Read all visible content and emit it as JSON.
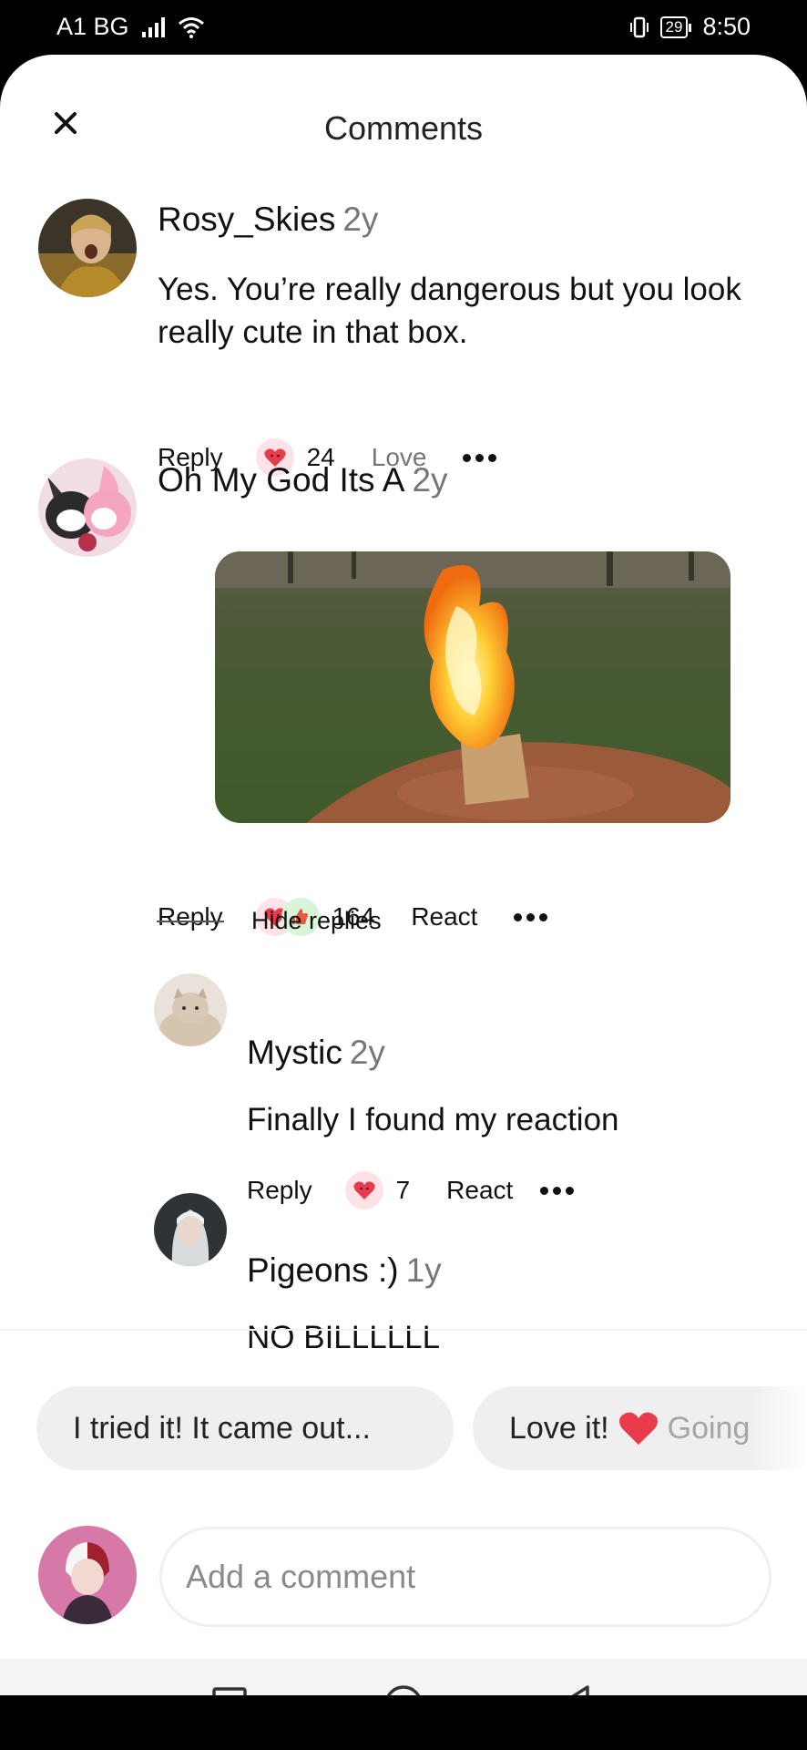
{
  "status_bar": {
    "carrier": "A1 BG",
    "battery": "29",
    "time": "8:50"
  },
  "header": {
    "title": "Comments"
  },
  "comments": [
    {
      "username": "Rosy_Skies",
      "time": "2y",
      "text": "Yes. You’re really dangerous but you look really cute in that box.",
      "actions": {
        "reply": "Reply",
        "count": "24",
        "react": "Love"
      }
    },
    {
      "username": "Oh My God Its A",
      "time": "2y",
      "image": "burning cardboard box outdoors",
      "actions": {
        "reply": "Reply",
        "count": "164",
        "react": "React"
      },
      "hide_replies": "Hide replies",
      "replies": [
        {
          "username": "Mystic",
          "time": "2y",
          "text": "Finally I found my reaction",
          "actions": {
            "reply": "Reply",
            "count": "7",
            "react": "React"
          }
        },
        {
          "username": "Pigeons :)",
          "time": "1y",
          "text": "NO BILLLLLL"
        }
      ]
    }
  ],
  "suggestions": [
    {
      "label": "I tried it! It came out..."
    },
    {
      "label": "Love it!",
      "faded": "Going"
    }
  ],
  "input": {
    "placeholder": "Add a comment"
  },
  "colors": {
    "heart": "#e83b4b",
    "reaction_bg": "#fde3e5",
    "chip_bg": "#efefef",
    "muted": "#767676"
  }
}
